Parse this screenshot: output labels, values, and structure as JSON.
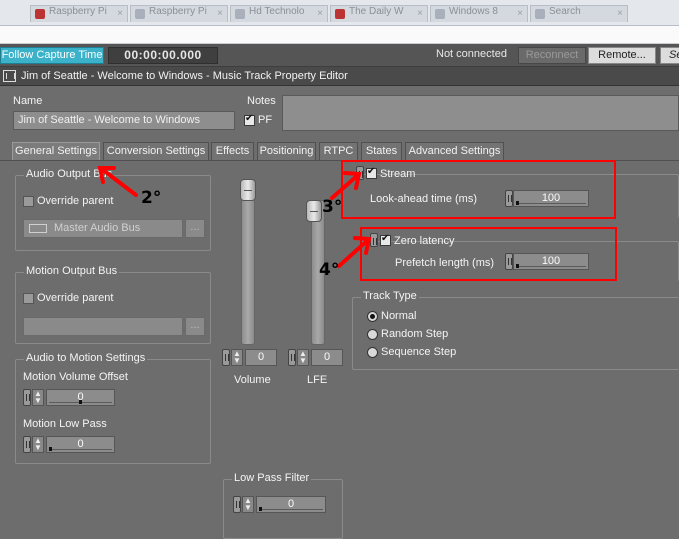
{
  "browser_tabs": [
    {
      "label": "Raspberry Pi",
      "favicon": "raspberry-icon"
    },
    {
      "label": "Raspberry Pi",
      "favicon": "page-icon"
    },
    {
      "label": "Hd Technolo",
      "favicon": "page-icon"
    },
    {
      "label": "The Daily W",
      "favicon": "page-icon"
    },
    {
      "label": "Windows 8",
      "favicon": "page-icon"
    },
    {
      "label": "Search",
      "favicon": "page-icon"
    }
  ],
  "transport": {
    "follow_label": "Follow Capture Time",
    "timecode": "00:00:00.000",
    "status": "Not connected",
    "reconnect_label": "Reconnect",
    "remote_label": "Remote...",
    "search_label": "Se"
  },
  "window": {
    "title": "Jim of Seattle - Welcome to Windows - Music Track Property Editor"
  },
  "properties": {
    "name_label": "Name",
    "name_value": "Jim of Seattle - Welcome to Windows",
    "notes_label": "Notes",
    "pf_label": "PF",
    "pf_checked": true
  },
  "tabs": [
    {
      "label": "General Settings",
      "active": true
    },
    {
      "label": "Conversion Settings",
      "active": false
    },
    {
      "label": "Effects",
      "active": false
    },
    {
      "label": "Positioning",
      "active": false
    },
    {
      "label": "RTPC",
      "active": false
    },
    {
      "label": "States",
      "active": false
    },
    {
      "label": "Advanced Settings",
      "active": false
    }
  ],
  "audio_output_bus": {
    "title": "Audio Output Bus",
    "override_label": "Override parent",
    "bus_value": "Master Audio Bus",
    "browse_label": "..."
  },
  "motion_output_bus": {
    "title": "Motion Output Bus",
    "override_label": "Override parent",
    "browse_label": "..."
  },
  "audio_to_motion": {
    "title": "Audio to Motion Settings",
    "volume_offset_label": "Motion Volume Offset",
    "volume_offset_value": "0",
    "low_pass_label": "Motion Low Pass",
    "low_pass_value": "0"
  },
  "faders": {
    "volume_label": "Volume",
    "volume_value": "0",
    "lfe_label": "LFE",
    "lfe_value": "0"
  },
  "low_pass_filter": {
    "title": "Low Pass Filter",
    "value": "0"
  },
  "stream": {
    "label": "Stream",
    "checked": true,
    "lookahead_label": "Look-ahead time (ms)",
    "lookahead_value": "100"
  },
  "zero_latency": {
    "label": "Zero latency",
    "checked": true,
    "prefetch_label": "Prefetch length (ms)",
    "prefetch_value": "100"
  },
  "track_type": {
    "title": "Track Type",
    "options": [
      "Normal",
      "Random Step",
      "Sequence Step"
    ],
    "selected": "Normal"
  },
  "annotations": {
    "step2": "2°",
    "step3": "3°",
    "step4": "4°",
    "color": "#ff0000"
  }
}
